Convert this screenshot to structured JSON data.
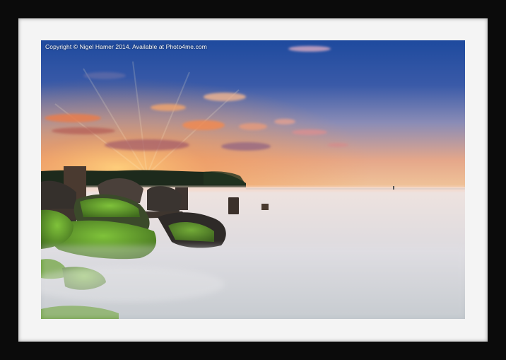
{
  "product": {
    "type": "framed mounted print",
    "frame_color": "#0b0b0b",
    "mount_color": "#f4f4f4"
  },
  "photo": {
    "copyright_text": "Copyright © Nigel Hamer 2014. Available at Photo4me.com",
    "colors": {
      "sky_top": "#1f4fa3",
      "sky_mid": "#7d86b8",
      "sunrise_glow": "#f6a65a",
      "sea_mist": "#e6e2e4",
      "moss_green": "#5f9a28",
      "rock_dark": "#2e2a28",
      "treeline": "#1d2a1c"
    }
  }
}
